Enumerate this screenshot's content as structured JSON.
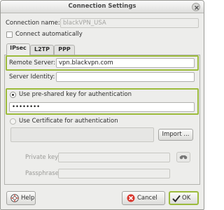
{
  "window": {
    "title": "Connection Settings"
  },
  "connection": {
    "name_label": "Connection name:",
    "name_value": "blackVPN_USA",
    "auto_connect_label": "Connect automatically",
    "auto_connect_checked": false
  },
  "tabs": [
    {
      "label": "IPsec",
      "active": true
    },
    {
      "label": "L2TP",
      "active": false
    },
    {
      "label": "PPP",
      "active": false
    }
  ],
  "ipsec": {
    "remote_server_label": "Remote Server:",
    "remote_server_value": "vpn.blackvpn.com",
    "server_identity_label": "Server Identity:",
    "server_identity_value": "",
    "psk_option_label": "Use pre-shared key for authentication",
    "psk_selected": true,
    "psk_value": "••••••••",
    "cert_option_label": "Use Certificate for authentication",
    "import_button": "Import ...",
    "private_key_label": "Private key:",
    "passphrase_label": "Passphrase:"
  },
  "footer": {
    "help_button": "Help",
    "cancel_button": "Cancel",
    "ok_button": "OK"
  },
  "colors": {
    "highlight": "#9cbb3c",
    "cancel_icon": "#d9342b",
    "ok_check": "#2a2a2a"
  },
  "icons": [
    "close-icon",
    "help-icon",
    "key-icon",
    "cancel-icon",
    "ok-check-icon"
  ]
}
